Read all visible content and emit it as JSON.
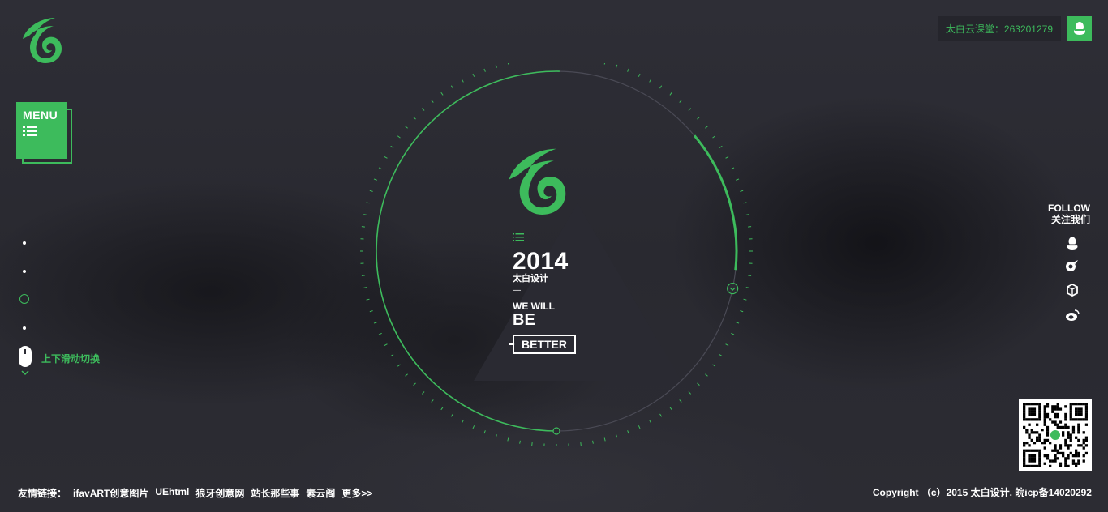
{
  "colors": {
    "accent": "#3dbb5c",
    "background": "#2b2b33",
    "triangle": "#2a2a32"
  },
  "header": {
    "logo_icon": "swirl-logo-icon",
    "qq_group_text": "太白云课堂：263201279",
    "qq_icon": "qq-penguin-icon"
  },
  "menu": {
    "label": "MENU",
    "icon": "list-icon"
  },
  "pager": {
    "count": 4,
    "active_index": 2
  },
  "scroll_hint": {
    "text": "上下滑动切换",
    "icon": "mouse-icon"
  },
  "hero": {
    "year": "2014",
    "brand": "太白设计",
    "dash": "—",
    "line1": "WE WILL",
    "line2": "BE",
    "button": "BETTER"
  },
  "follow": {
    "en": "FOLLOW",
    "cn": "关注我们",
    "icons": [
      "qq-icon",
      "taobao-icon",
      "box-icon",
      "weibo-icon"
    ]
  },
  "qr_icon": "qr-code-icon",
  "footer": {
    "friends_label": "友情链接：",
    "links": [
      "ifavART创意图片",
      "UEhtml",
      "狼牙创意网",
      "站长那些事",
      "素云阁",
      "更多>>"
    ],
    "copyright": "Copyright （c）2015 太白设计. 皖icp备14020292"
  }
}
